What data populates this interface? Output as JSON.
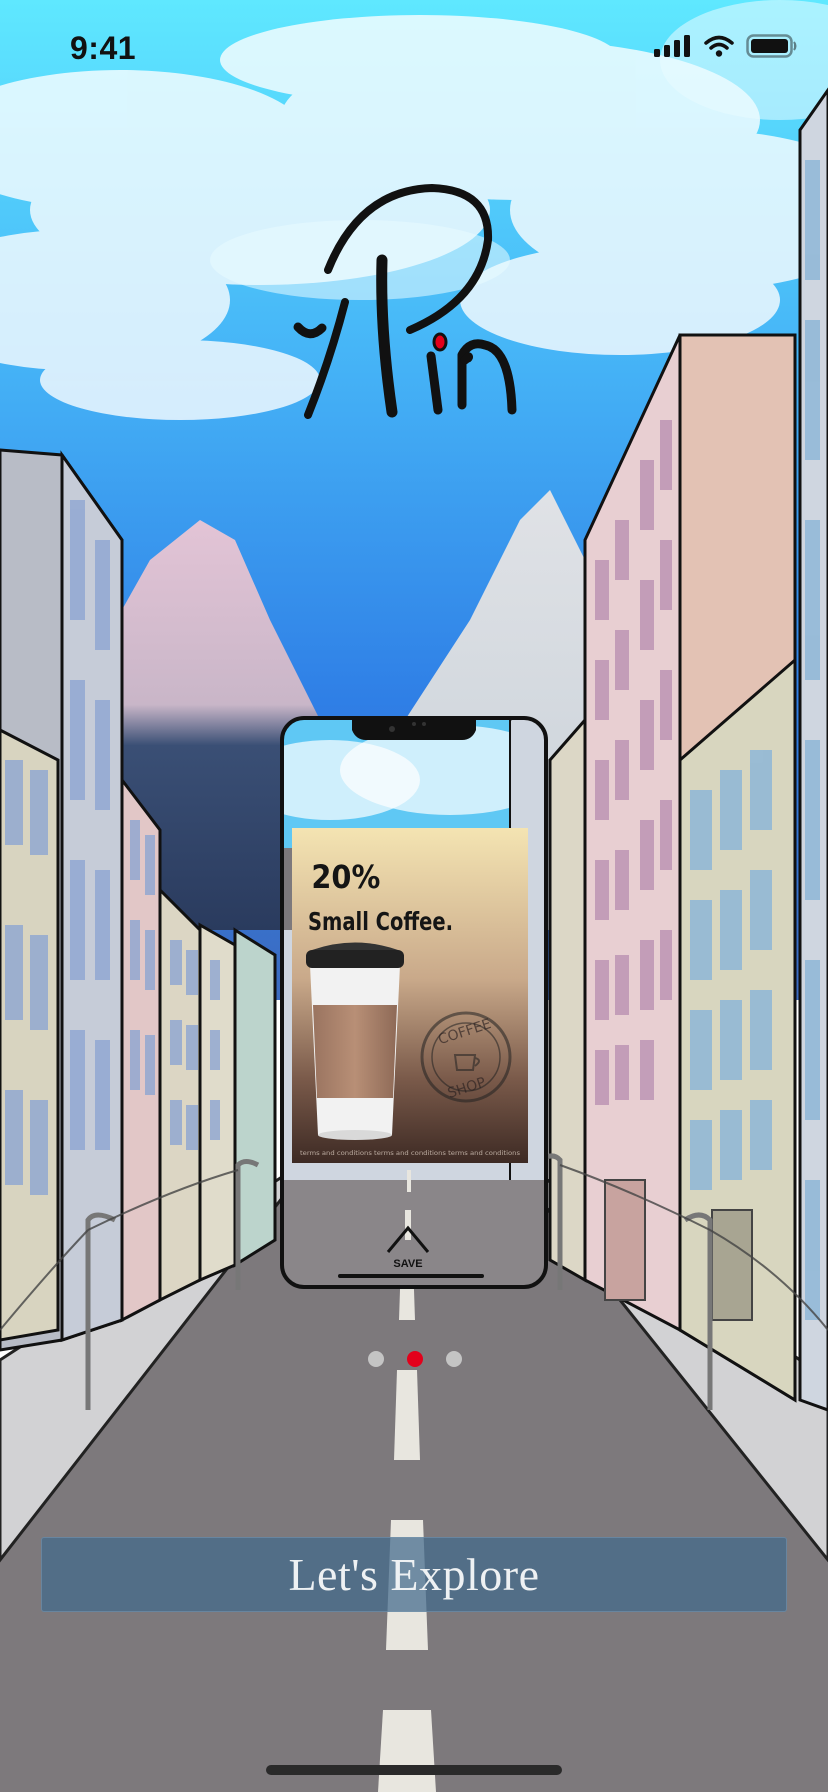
{
  "status_bar": {
    "time": "9:41",
    "icons": [
      "cellular-signal-icon",
      "wifi-icon",
      "battery-icon"
    ]
  },
  "app": {
    "logo_text": "yPin"
  },
  "preview": {
    "ad": {
      "discount": "20%",
      "product": "Small Coffee.",
      "stamp_top": "COFFEE",
      "stamp_bottom": "SHOP",
      "fine_print": "terms and conditions terms and conditions terms and conditions"
    },
    "save_label": "SAVE"
  },
  "pagination": {
    "count": 3,
    "active_index": 1,
    "active_color": "#e3001b",
    "inactive_color": "#c4c4c4"
  },
  "cta": {
    "label": "Let's Explore"
  },
  "colors": {
    "accent": "#e3001b",
    "sky_top": "#5fe8ff",
    "sky_bottom": "#2f7fe6",
    "road": "#7d797c",
    "button_bg": "#41698c"
  }
}
